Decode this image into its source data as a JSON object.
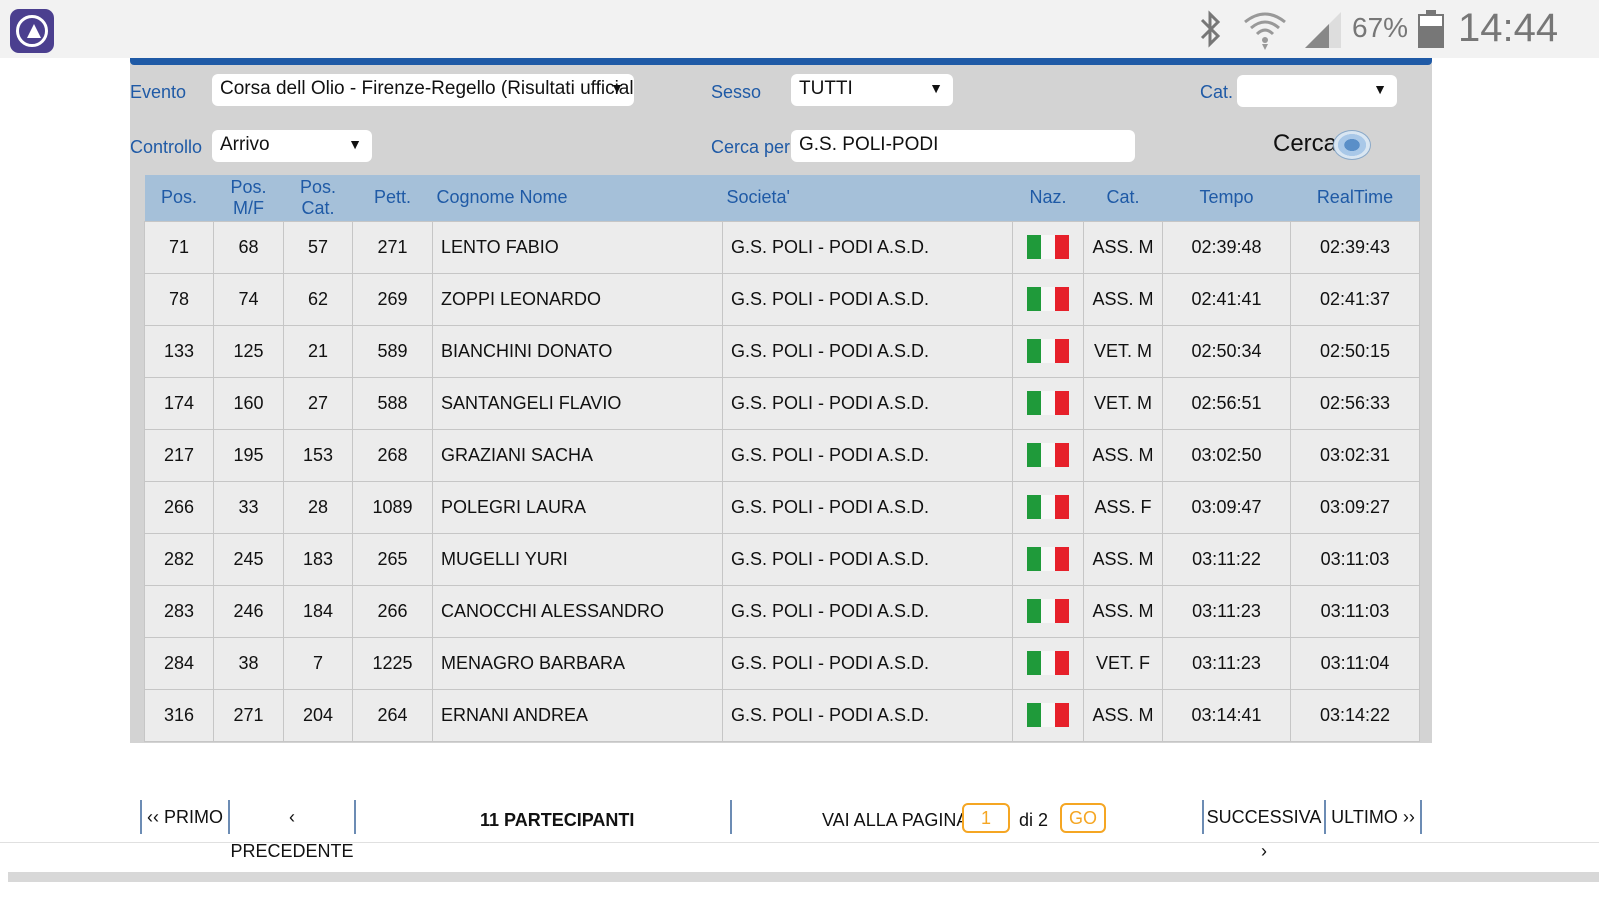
{
  "status_bar": {
    "battery_percent": "67%",
    "battery_level": 0.67,
    "time": "14:44",
    "icons": [
      "app-icon",
      "bluetooth-icon",
      "wifi-icon",
      "signal-icon",
      "battery-icon"
    ]
  },
  "filters": {
    "evento_label": "Evento",
    "evento_value": "Corsa dell Olio - Firenze-Regello (Risultati ufficiali)",
    "sesso_label": "Sesso",
    "sesso_value": "TUTTI",
    "cat_label": "Cat.",
    "cat_value": "",
    "controllo_label": "Controllo",
    "controllo_value": "Arrivo",
    "cerca_per_label": "Cerca per",
    "cerca_per_value": "G.S. POLI-PODI",
    "cerca_button": "Cerca"
  },
  "table": {
    "headers": [
      "Pos.",
      "Pos. M/F",
      "Pos. Cat.",
      "Pett.",
      "Cognome Nome",
      "Societa'",
      "Naz.",
      "Cat.",
      "Tempo",
      "RealTime"
    ],
    "rows": [
      {
        "pos": "71",
        "pos_mf": "68",
        "pos_cat": "57",
        "pett": "271",
        "nome": "LENTO FABIO",
        "societa": "G.S. POLI - PODI A.S.D.",
        "naz": "italy-flag-icon",
        "cat": "ASS. M",
        "tempo": "02:39:48",
        "realtime": "02:39:43"
      },
      {
        "pos": "78",
        "pos_mf": "74",
        "pos_cat": "62",
        "pett": "269",
        "nome": "ZOPPI LEONARDO",
        "societa": "G.S. POLI - PODI A.S.D.",
        "naz": "italy-flag-icon",
        "cat": "ASS. M",
        "tempo": "02:41:41",
        "realtime": "02:41:37"
      },
      {
        "pos": "133",
        "pos_mf": "125",
        "pos_cat": "21",
        "pett": "589",
        "nome": "BIANCHINI DONATO",
        "societa": "G.S. POLI - PODI A.S.D.",
        "naz": "italy-flag-icon",
        "cat": "VET. M",
        "tempo": "02:50:34",
        "realtime": "02:50:15"
      },
      {
        "pos": "174",
        "pos_mf": "160",
        "pos_cat": "27",
        "pett": "588",
        "nome": "SANTANGELI FLAVIO",
        "societa": "G.S. POLI - PODI A.S.D.",
        "naz": "italy-flag-icon",
        "cat": "VET. M",
        "tempo": "02:56:51",
        "realtime": "02:56:33"
      },
      {
        "pos": "217",
        "pos_mf": "195",
        "pos_cat": "153",
        "pett": "268",
        "nome": "GRAZIANI SACHA",
        "societa": "G.S. POLI - PODI A.S.D.",
        "naz": "italy-flag-icon",
        "cat": "ASS. M",
        "tempo": "03:02:50",
        "realtime": "03:02:31"
      },
      {
        "pos": "266",
        "pos_mf": "33",
        "pos_cat": "28",
        "pett": "1089",
        "nome": "POLEGRI LAURA",
        "societa": "G.S. POLI - PODI A.S.D.",
        "naz": "italy-flag-icon",
        "cat": "ASS. F",
        "tempo": "03:09:47",
        "realtime": "03:09:27"
      },
      {
        "pos": "282",
        "pos_mf": "245",
        "pos_cat": "183",
        "pett": "265",
        "nome": "MUGELLI YURI",
        "societa": "G.S. POLI - PODI A.S.D.",
        "naz": "italy-flag-icon",
        "cat": "ASS. M",
        "tempo": "03:11:22",
        "realtime": "03:11:03"
      },
      {
        "pos": "283",
        "pos_mf": "246",
        "pos_cat": "184",
        "pett": "266",
        "nome": "CANOCCHI ALESSANDRO",
        "societa": "G.S. POLI - PODI A.S.D.",
        "naz": "italy-flag-icon",
        "cat": "ASS. M",
        "tempo": "03:11:23",
        "realtime": "03:11:03"
      },
      {
        "pos": "284",
        "pos_mf": "38",
        "pos_cat": "7",
        "pett": "1225",
        "nome": "MENAGRO BARBARA",
        "societa": "G.S. POLI - PODI A.S.D.",
        "naz": "italy-flag-icon",
        "cat": "VET. F",
        "tempo": "03:11:23",
        "realtime": "03:11:04"
      },
      {
        "pos": "316",
        "pos_mf": "271",
        "pos_cat": "204",
        "pett": "264",
        "nome": "ERNANI ANDREA",
        "societa": "G.S. POLI - PODI A.S.D.",
        "naz": "italy-flag-icon",
        "cat": "ASS. M",
        "tempo": "03:14:41",
        "realtime": "03:14:22"
      }
    ]
  },
  "pager": {
    "primo": "‹‹ PRIMO",
    "precedente": "‹ PRECEDENTE",
    "count": "11 PARTECIPANTI",
    "vai_label": "VAI ALLA PAGINA",
    "page_value": "1",
    "di_label": "di",
    "total_pages": "2",
    "go": "GO",
    "successiva": "SUCCESSIVA ›",
    "ultimo": "ULTIMO ››"
  },
  "colors": {
    "accent_blue": "#1f5aa6",
    "header_blue": "#a5c0d9",
    "panel_gray": "#d3d3d3",
    "go_orange": "#f5a623"
  }
}
